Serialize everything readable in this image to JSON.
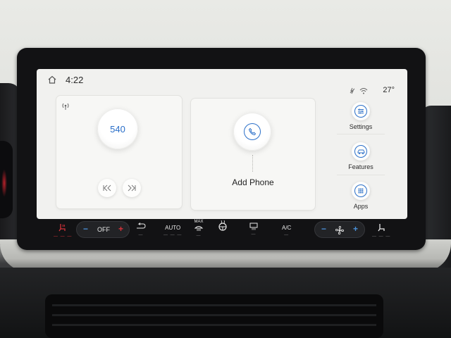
{
  "status_bar": {
    "time": "4:22",
    "temperature": "27°",
    "icons": [
      "home-icon",
      "wireless-charging-icon",
      "wifi-icon"
    ]
  },
  "radio": {
    "frequency": "540",
    "icons": [
      "broadcast-icon",
      "previous-track-icon",
      "next-track-icon"
    ]
  },
  "phone": {
    "label": "Add Phone",
    "icon": "phone-icon"
  },
  "side_menu": {
    "items": [
      {
        "label": "Settings",
        "icon": "settings-sliders-icon"
      },
      {
        "label": "Features",
        "icon": "car-icon"
      },
      {
        "label": "Apps",
        "icon": "apps-grid-icon"
      }
    ]
  },
  "climate": {
    "driver_temp_label": "OFF",
    "auto_label": "AUTO",
    "max_label": "MAX",
    "ac_label": "A/C",
    "icons": [
      "heated-seat-icon",
      "recirculation-icon",
      "max-defrost-icon",
      "heated-steering-icon",
      "rear-defrost-icon",
      "fan-icon",
      "passenger-seat-icon"
    ],
    "colors": {
      "cool": "#4a90d9",
      "heat": "#d6323a",
      "accent": "#2a6fc9"
    }
  }
}
